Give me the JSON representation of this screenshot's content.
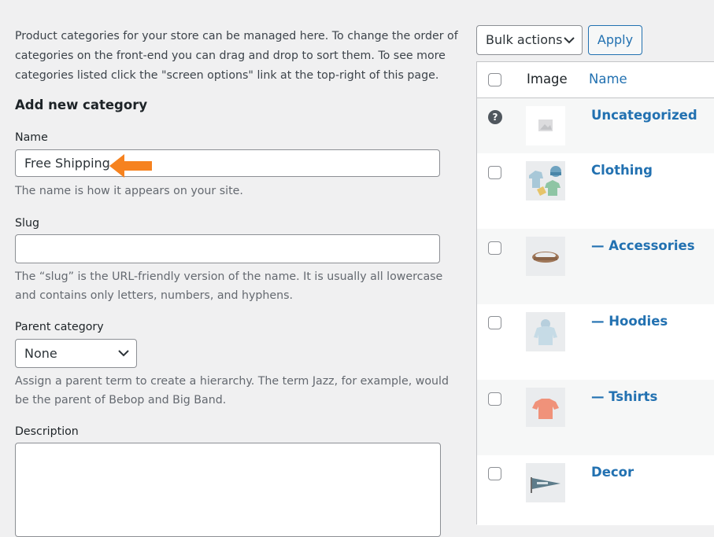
{
  "form": {
    "intro": "Product categories for your store can be managed here. To change the order of categories on the front-end you can drag and drop to sort them. To see more categories listed click the \"screen options\" link at the top-right of this page.",
    "heading": "Add new category",
    "name_label": "Name",
    "name_value": "Free Shipping",
    "name_help": "The name is how it appears on your site.",
    "slug_label": "Slug",
    "slug_value": "",
    "slug_help": "The “slug” is the URL-friendly version of the name. It is usually all lowercase and contains only letters, numbers, and hyphens.",
    "parent_label": "Parent category",
    "parent_value": "None",
    "parent_help": "Assign a parent term to create a hierarchy. The term Jazz, for example, would be the parent of Bebop and Big Band.",
    "description_label": "Description",
    "description_value": "",
    "accent_color": "#f6821f"
  },
  "list": {
    "bulk_label": "Bulk actions",
    "apply_label": "Apply",
    "col_image": "Image",
    "col_name": "Name",
    "rows": [
      {
        "name": "Uncategorized",
        "icon": "placeholder-image-icon"
      },
      {
        "name": "Clothing",
        "icon": "clothing-thumbnail"
      },
      {
        "name": "— Accessories",
        "icon": "belt-thumbnail"
      },
      {
        "name": "— Hoodies",
        "icon": "hoodie-thumbnail"
      },
      {
        "name": "— Tshirts",
        "icon": "tshirt-thumbnail"
      },
      {
        "name": "Decor",
        "icon": "pennant-thumbnail"
      }
    ],
    "link_color": "#2271b1"
  }
}
